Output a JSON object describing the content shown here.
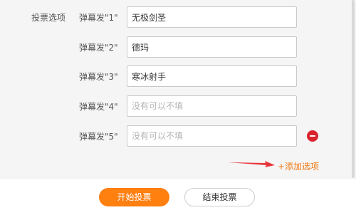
{
  "poll": {
    "section_label": "投票选项",
    "options": [
      {
        "label": "弹幕发\"1\"",
        "value": "无极剑圣",
        "placeholder": ""
      },
      {
        "label": "弹幕发\"2\"",
        "value": "德玛",
        "placeholder": ""
      },
      {
        "label": "弹幕发\"3\"",
        "value": "寒冰射手",
        "placeholder": ""
      },
      {
        "label": "弹幕发\"4\"",
        "value": "",
        "placeholder": "没有可以不填"
      },
      {
        "label": "弹幕发\"5\"",
        "value": "",
        "placeholder": "没有可以不填"
      }
    ],
    "add_option_label": "+添加选项",
    "remove_icon": "minus-circle-icon"
  },
  "footer": {
    "start_label": "开始投票",
    "end_label": "结束投票"
  },
  "colors": {
    "accent": "#ff7f0f",
    "link": "#f07a14",
    "danger": "#d9232d",
    "annotation_arrow": "#e8343b"
  }
}
